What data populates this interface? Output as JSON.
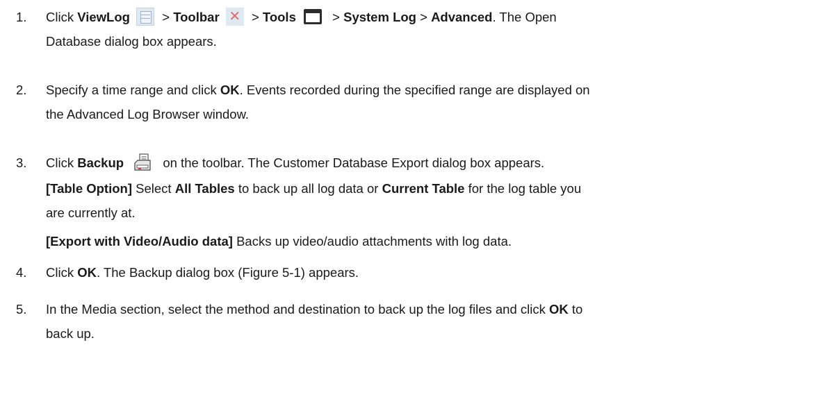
{
  "steps": [
    {
      "number": "1.",
      "line1": {
        "t1": "Click ",
        "b1": "ViewLog",
        "t2": " > ",
        "b2": "Toolbar",
        "t3": " > ",
        "b3": "Tools",
        "t4": " > ",
        "b4": "System Log",
        "t5": " > ",
        "b5": "Advanced",
        "t6": ". The Open"
      },
      "line2": "Database dialog box appears."
    },
    {
      "number": "2.",
      "line1": {
        "t1": "Specify a time range and click ",
        "b1": "OK",
        "t2": ". Events recorded during the specified range are displayed on"
      },
      "line2": "the Advanced Log Browser window."
    },
    {
      "number": "3.",
      "line1": {
        "t1": "Click ",
        "b1": "Backup",
        "t2": " on the toolbar. The Customer Database Export dialog box appears."
      },
      "table_option": {
        "b1": "[Table Option]",
        "t1": " Select ",
        "b2": "All Tables",
        "t2": " to back up all log data or ",
        "b3": "Current Table",
        "t3": " for the log table you",
        "line2": "are currently at."
      },
      "export_option": {
        "b1": "[Export with Video/Audio data]",
        "t1": " Backs up video/audio attachments with log data."
      }
    },
    {
      "number": "4.",
      "line1": {
        "t1": "Click ",
        "b1": "OK",
        "t2": ". The Backup dialog box (Figure 5-1) appears."
      }
    },
    {
      "number": "5.",
      "line1": {
        "t1": "In the Media section, select the method and destination to back up the log files and click ",
        "b1": "OK",
        "t2": " to"
      },
      "line2": "back up."
    }
  ],
  "icons": {
    "viewlog": "viewlog-icon",
    "toolbar": "toolbar-icon",
    "tools": "tools-window-icon",
    "backup": "backup-icon",
    "toolbar_glyph": "✕",
    "accent_color": "#e06c6c",
    "icon_bg": "#dfe9f2"
  }
}
